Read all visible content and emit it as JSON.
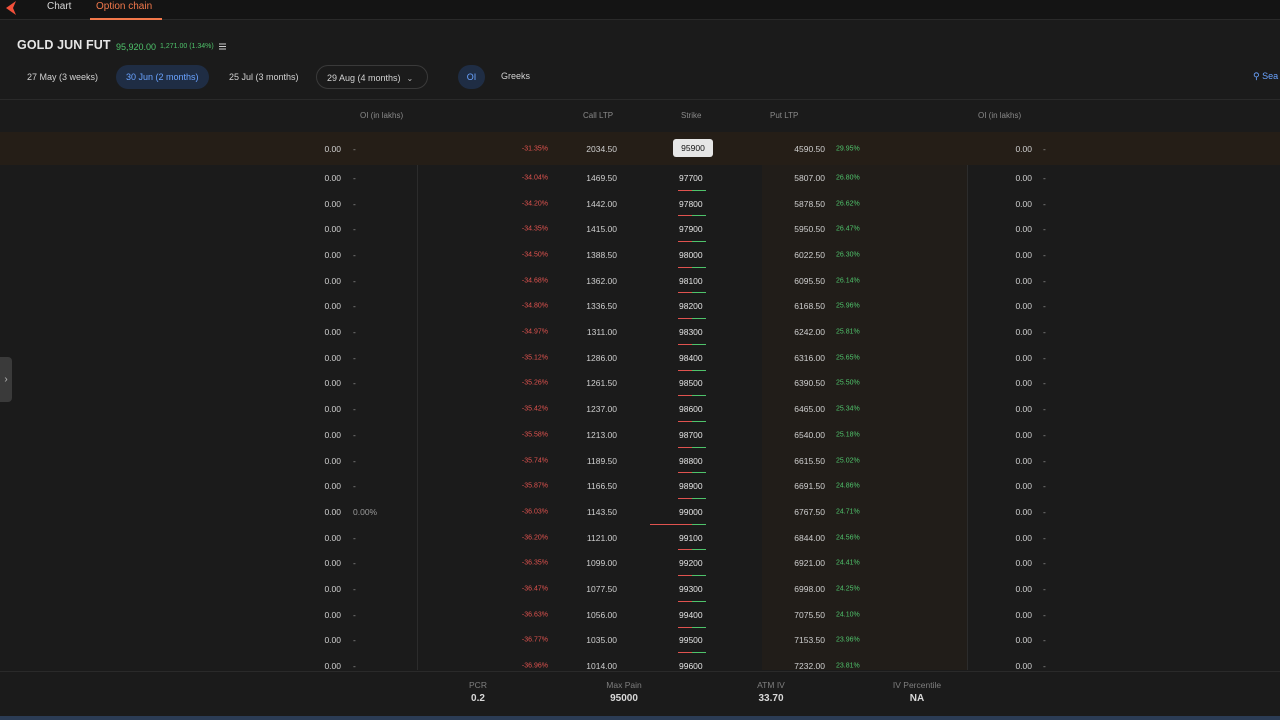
{
  "topbar": {
    "tabs": [
      {
        "label": "Chart"
      },
      {
        "label": "Option chain"
      }
    ]
  },
  "instrument": {
    "name": "GOLD JUN FUT",
    "ltp": "95,920.00",
    "change": "1,271.00 (1.34%)"
  },
  "expiries": [
    {
      "label": "27 May (3 weeks)"
    },
    {
      "label": "30 Jun (2 months)"
    },
    {
      "label": "25 Jul (3 months)"
    },
    {
      "label": "29 Aug (4 months)"
    }
  ],
  "toggles": {
    "oi": "OI",
    "greeks": "Greeks",
    "search": "Sea"
  },
  "columns": {
    "call_oi": "OI (in lakhs)",
    "call_ltp": "Call LTP",
    "strike": "Strike",
    "put_ltp": "Put LTP",
    "put_oi": "OI (in lakhs)"
  },
  "rows": [
    {
      "coi": "0.00",
      "coich": "-",
      "cch": "-31.35%",
      "cltp": "2034.50",
      "strike": "95900",
      "pltp": "4590.50",
      "pch": "29.95%",
      "poi": "0.00",
      "poich": "-"
    },
    {
      "coi": "0.00",
      "coich": "-",
      "cch": "-34.04%",
      "cltp": "1469.50",
      "strike": "97700",
      "pltp": "5807.00",
      "pch": "26.80%",
      "poi": "0.00",
      "poich": "-"
    },
    {
      "coi": "0.00",
      "coich": "-",
      "cch": "-34.20%",
      "cltp": "1442.00",
      "strike": "97800",
      "pltp": "5878.50",
      "pch": "26.62%",
      "poi": "0.00",
      "poich": "-"
    },
    {
      "coi": "0.00",
      "coich": "-",
      "cch": "-34.35%",
      "cltp": "1415.00",
      "strike": "97900",
      "pltp": "5950.50",
      "pch": "26.47%",
      "poi": "0.00",
      "poich": "-"
    },
    {
      "coi": "0.00",
      "coich": "-",
      "cch": "-34.50%",
      "cltp": "1388.50",
      "strike": "98000",
      "pltp": "6022.50",
      "pch": "26.30%",
      "poi": "0.00",
      "poich": "-"
    },
    {
      "coi": "0.00",
      "coich": "-",
      "cch": "-34.68%",
      "cltp": "1362.00",
      "strike": "98100",
      "pltp": "6095.50",
      "pch": "26.14%",
      "poi": "0.00",
      "poich": "-"
    },
    {
      "coi": "0.00",
      "coich": "-",
      "cch": "-34.80%",
      "cltp": "1336.50",
      "strike": "98200",
      "pltp": "6168.50",
      "pch": "25.96%",
      "poi": "0.00",
      "poich": "-"
    },
    {
      "coi": "0.00",
      "coich": "-",
      "cch": "-34.97%",
      "cltp": "1311.00",
      "strike": "98300",
      "pltp": "6242.00",
      "pch": "25.81%",
      "poi": "0.00",
      "poich": "-"
    },
    {
      "coi": "0.00",
      "coich": "-",
      "cch": "-35.12%",
      "cltp": "1286.00",
      "strike": "98400",
      "pltp": "6316.00",
      "pch": "25.65%",
      "poi": "0.00",
      "poich": "-"
    },
    {
      "coi": "0.00",
      "coich": "-",
      "cch": "-35.26%",
      "cltp": "1261.50",
      "strike": "98500",
      "pltp": "6390.50",
      "pch": "25.50%",
      "poi": "0.00",
      "poich": "-"
    },
    {
      "coi": "0.00",
      "coich": "-",
      "cch": "-35.42%",
      "cltp": "1237.00",
      "strike": "98600",
      "pltp": "6465.00",
      "pch": "25.34%",
      "poi": "0.00",
      "poich": "-"
    },
    {
      "coi": "0.00",
      "coich": "-",
      "cch": "-35.58%",
      "cltp": "1213.00",
      "strike": "98700",
      "pltp": "6540.00",
      "pch": "25.18%",
      "poi": "0.00",
      "poich": "-"
    },
    {
      "coi": "0.00",
      "coich": "-",
      "cch": "-35.74%",
      "cltp": "1189.50",
      "strike": "98800",
      "pltp": "6615.50",
      "pch": "25.02%",
      "poi": "0.00",
      "poich": "-"
    },
    {
      "coi": "0.00",
      "coich": "-",
      "cch": "-35.87%",
      "cltp": "1166.50",
      "strike": "98900",
      "pltp": "6691.50",
      "pch": "24.86%",
      "poi": "0.00",
      "poich": "-"
    },
    {
      "coi": "0.00",
      "coich": "0.00%",
      "cch": "-36.03%",
      "cltp": "1143.50",
      "strike": "99000",
      "pltp": "6767.50",
      "pch": "24.71%",
      "poi": "0.00",
      "poich": "-"
    },
    {
      "coi": "0.00",
      "coich": "-",
      "cch": "-36.20%",
      "cltp": "1121.00",
      "strike": "99100",
      "pltp": "6844.00",
      "pch": "24.56%",
      "poi": "0.00",
      "poich": "-"
    },
    {
      "coi": "0.00",
      "coich": "-",
      "cch": "-36.35%",
      "cltp": "1099.00",
      "strike": "99200",
      "pltp": "6921.00",
      "pch": "24.41%",
      "poi": "0.00",
      "poich": "-"
    },
    {
      "coi": "0.00",
      "coich": "-",
      "cch": "-36.47%",
      "cltp": "1077.50",
      "strike": "99300",
      "pltp": "6998.00",
      "pch": "24.25%",
      "poi": "0.00",
      "poich": "-"
    },
    {
      "coi": "0.00",
      "coich": "-",
      "cch": "-36.63%",
      "cltp": "1056.00",
      "strike": "99400",
      "pltp": "7075.50",
      "pch": "24.10%",
      "poi": "0.00",
      "poich": "-"
    },
    {
      "coi": "0.00",
      "coich": "-",
      "cch": "-36.77%",
      "cltp": "1035.00",
      "strike": "99500",
      "pltp": "7153.50",
      "pch": "23.96%",
      "poi": "0.00",
      "poich": "-"
    },
    {
      "coi": "0.00",
      "coich": "-",
      "cch": "-36.96%",
      "cltp": "1014.00",
      "strike": "99600",
      "pltp": "7232.00",
      "pch": "23.81%",
      "poi": "0.00",
      "poich": "-"
    }
  ],
  "footer": {
    "pcr_label": "PCR",
    "pcr": "0.2",
    "maxpain_label": "Max Pain",
    "maxpain": "95000",
    "atmiv_label": "ATM IV",
    "atmiv": "33.70",
    "ivp_label": "IV Percentile",
    "ivp": "NA"
  },
  "colors": {
    "accent": "#f2784b",
    "positive": "#4fc36b",
    "negative": "#e0534f",
    "link": "#6aa3ff"
  }
}
